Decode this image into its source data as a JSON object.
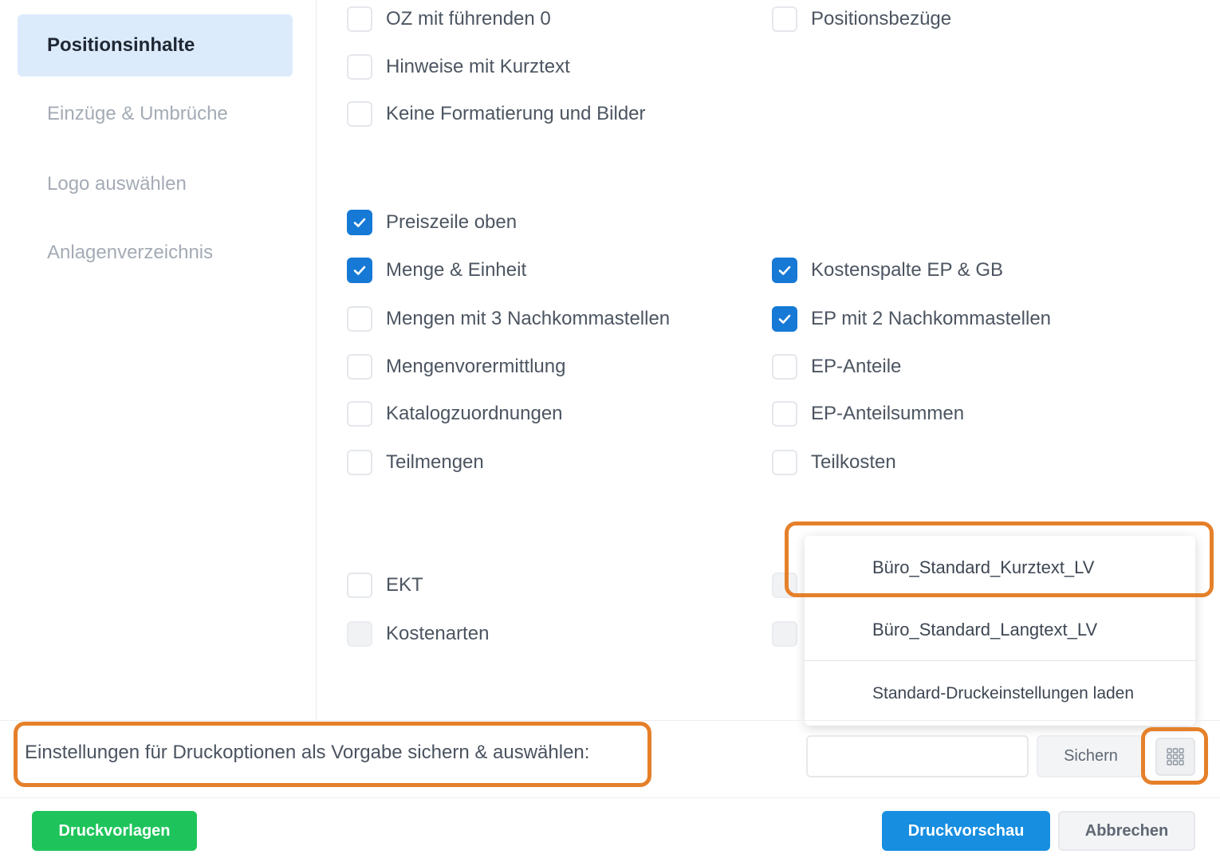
{
  "sidebar": {
    "items": [
      {
        "label": "Positionsinhalte",
        "active": true
      },
      {
        "label": "Einzüge & Umbrüche",
        "active": false
      },
      {
        "label": "Logo auswählen",
        "active": false
      },
      {
        "label": "Anlagenverzeichnis",
        "active": false
      }
    ]
  },
  "options": {
    "oz_fuehrende_null": {
      "label": "OZ mit führenden 0",
      "checked": false
    },
    "positionsbezuege": {
      "label": "Positionsbezüge",
      "checked": false
    },
    "hinweise_kurztext": {
      "label": "Hinweise mit Kurztext",
      "checked": false
    },
    "keine_formatierung": {
      "label": "Keine Formatierung und Bilder",
      "checked": false
    },
    "preiszeile_oben": {
      "label": "Preiszeile oben",
      "checked": true
    },
    "menge_einheit": {
      "label": "Menge & Einheit",
      "checked": true
    },
    "kostenspalte": {
      "label": "Kostenspalte EP & GB",
      "checked": true
    },
    "mengen_3_nachkomma": {
      "label": "Mengen mit 3 Nachkommastellen",
      "checked": false
    },
    "ep_2_nachkomma": {
      "label": "EP mit 2 Nachkommastellen",
      "checked": true
    },
    "mengenvorermittlung": {
      "label": "Mengenvorermittlung",
      "checked": false
    },
    "ep_anteile": {
      "label": "EP-Anteile",
      "checked": false
    },
    "katalogzuordnungen": {
      "label": "Katalogzuordnungen",
      "checked": false
    },
    "ep_anteilsummen": {
      "label": "EP-Anteilsummen",
      "checked": false
    },
    "teilmengen": {
      "label": "Teilmengen",
      "checked": false
    },
    "teilkosten": {
      "label": "Teilkosten",
      "checked": false
    },
    "ekt": {
      "label": "EKT",
      "checked": false
    },
    "kostenarten": {
      "label": "Kostenarten",
      "checked": false,
      "disabled": true
    }
  },
  "dropdown": {
    "items": [
      "Büro_Standard_Kurztext_LV",
      "Büro_Standard_Langtext_LV"
    ],
    "load_default": "Standard-Druckeinstellungen laden"
  },
  "preset_bar": {
    "label": "Einstellungen für Druckoptionen als Vorgabe sichern & auswählen:",
    "input_value": "",
    "save_label": "Sichern",
    "grid_icon": "grid-icon"
  },
  "footer": {
    "templates_label": "Druckvorlagen",
    "preview_label": "Druckvorschau",
    "cancel_label": "Abbrechen"
  },
  "colors": {
    "accent_blue": "#178ee0",
    "checkbox_blue": "#1679d6",
    "green": "#1ec45b",
    "highlight_orange": "#e5802a",
    "active_nav_bg": "#dcebfc"
  }
}
